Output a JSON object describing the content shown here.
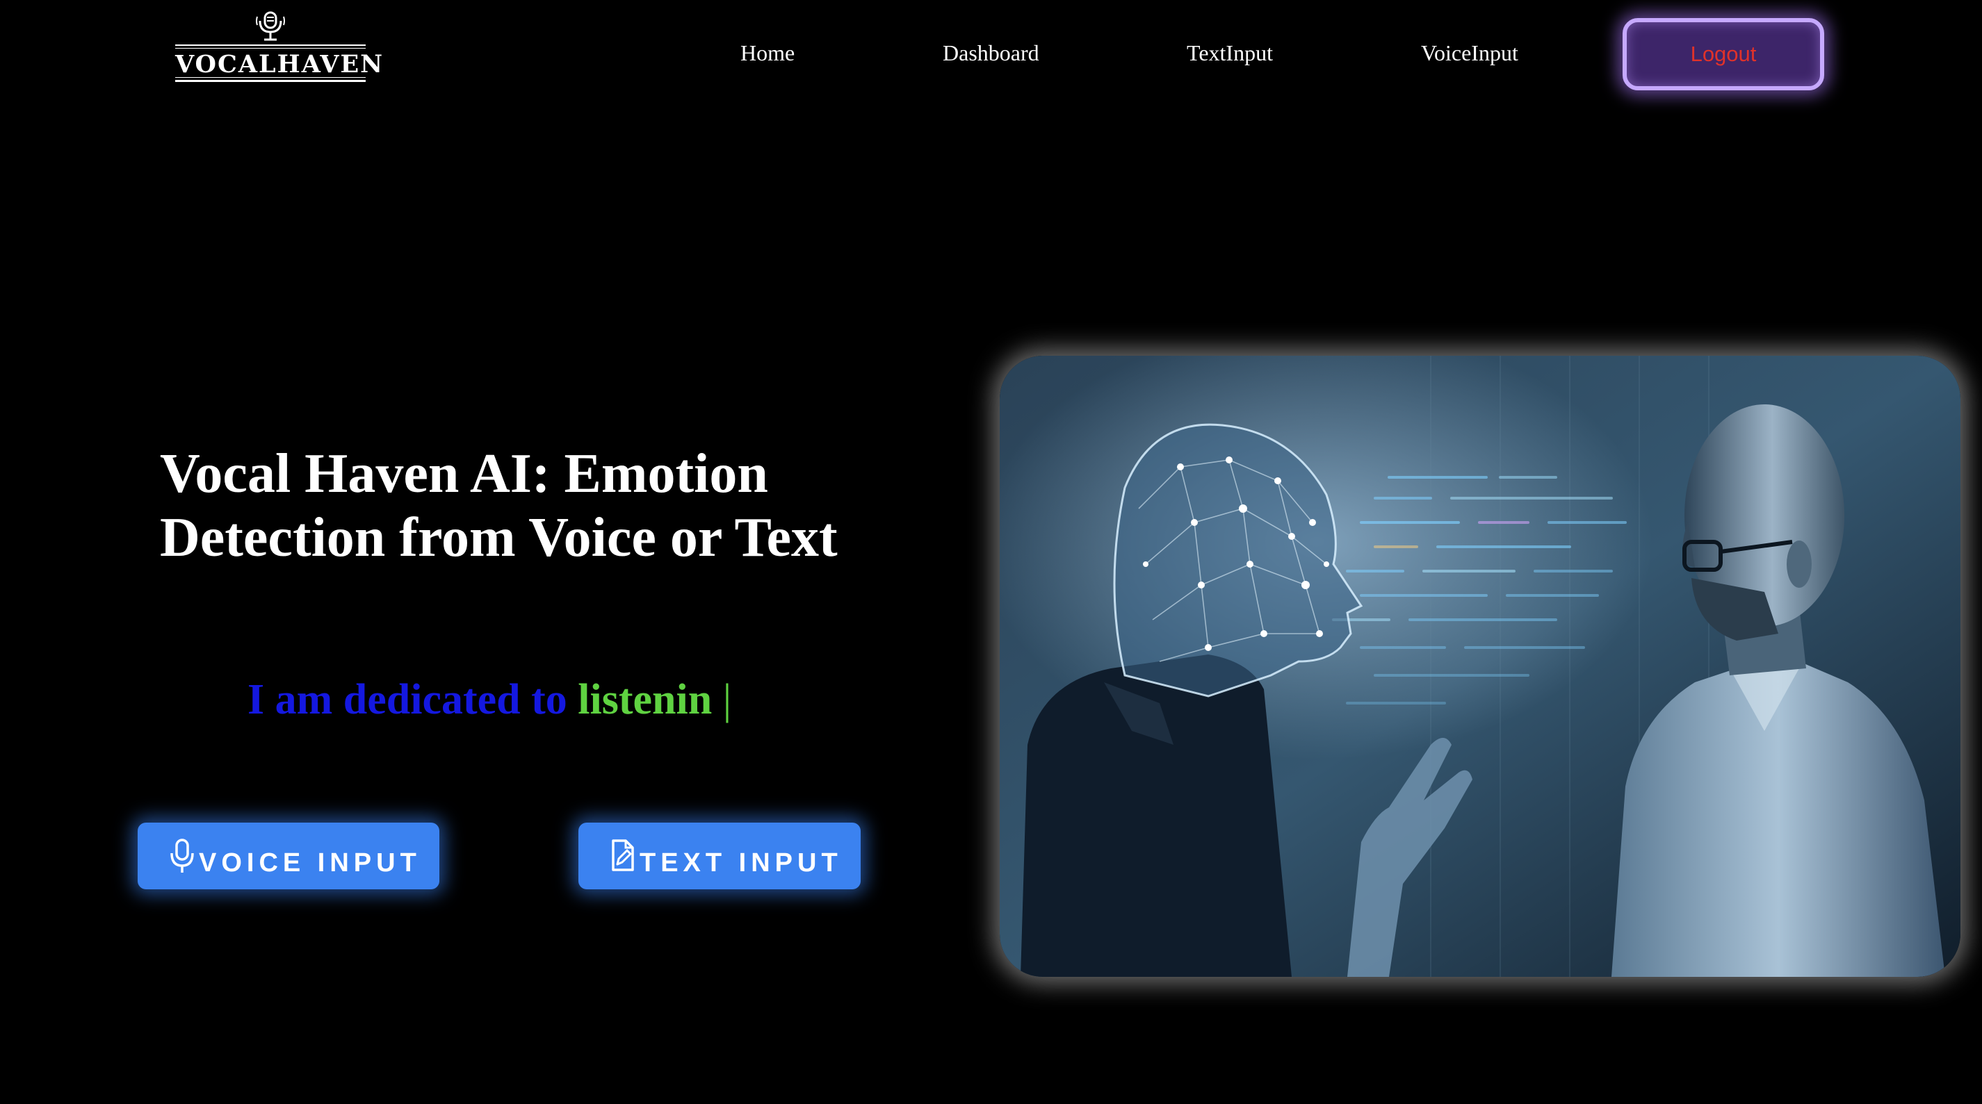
{
  "brand": {
    "name": "VOCALHAVEN",
    "logo_icon": "microphone-icon"
  },
  "nav": {
    "items": [
      {
        "label": "Home"
      },
      {
        "label": "Dashboard"
      },
      {
        "label": "TextInput"
      },
      {
        "label": "VoiceInput"
      }
    ],
    "logout_label": "Logout"
  },
  "hero": {
    "title_line1": "Vocal Haven AI: Emotion",
    "title_line2": "Detection from Voice or Text",
    "typing_static": "I am dedicated to",
    "typing_word": "listenin",
    "typing_cursor": "|"
  },
  "actions": {
    "voice": {
      "label": "VOICE INPUT",
      "icon": "microphone-icon"
    },
    "text": {
      "label": "TEXT INPUT",
      "icon": "document-edit-icon"
    }
  },
  "colors": {
    "background": "#000000",
    "accent_blue": "#3b82f0",
    "logout_bg": "#3d2569",
    "logout_text": "#e0322a",
    "typing_static": "#1418e0",
    "typing_word": "#5fd241"
  }
}
